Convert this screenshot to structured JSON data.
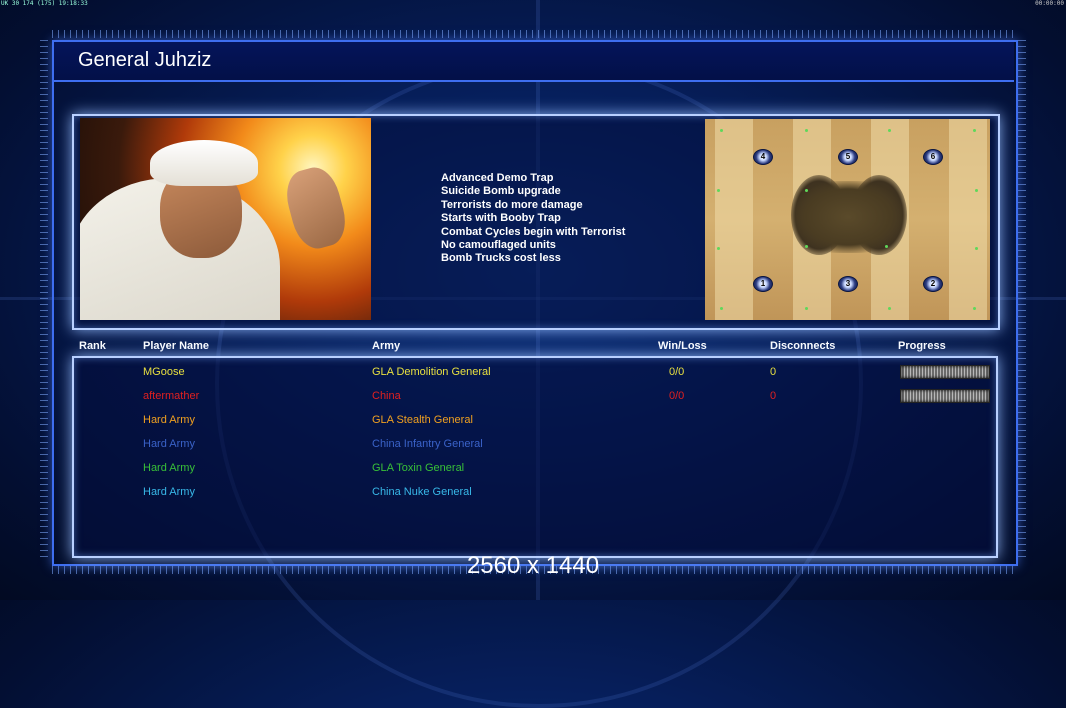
{
  "status_bar": {
    "left": "UK 30 174 (175) 19:18:33",
    "right": "00:00:00"
  },
  "general_title": "General Juhziz",
  "traits": [
    "Advanced Demo Trap",
    "Suicide Bomb upgrade",
    "Terrorists do more damage",
    "Starts with Booby Trap",
    "Combat Cycles begin with Terrorist",
    "No camouflaged units",
    "Bomb Trucks cost less"
  ],
  "map": {
    "spawns": [
      "4",
      "5",
      "6",
      "1",
      "3",
      "2"
    ]
  },
  "table": {
    "headers": {
      "rank": "Rank",
      "player_name": "Player Name",
      "army": "Army",
      "win_loss": "Win/Loss",
      "disconnects": "Disconnects",
      "progress": "Progress"
    },
    "rows": [
      {
        "player": "MGoose",
        "army": "GLA Demolition General",
        "win_loss": "0/0",
        "disconnects": "0",
        "color": "#e8e040",
        "has_progress": true
      },
      {
        "player": "aftermather",
        "army": "China",
        "win_loss": "0/0",
        "disconnects": "0",
        "color": "#e02020",
        "has_progress": true
      },
      {
        "player": "Hard Army",
        "army": "GLA Stealth General",
        "win_loss": "",
        "disconnects": "",
        "color": "#f0a020",
        "has_progress": false
      },
      {
        "player": "Hard Army",
        "army": "China Infantry General",
        "win_loss": "",
        "disconnects": "",
        "color": "#3a62c8",
        "has_progress": false
      },
      {
        "player": "Hard Army",
        "army": "GLA Toxin General",
        "win_loss": "",
        "disconnects": "",
        "color": "#38c038",
        "has_progress": false
      },
      {
        "player": "Hard Army",
        "army": "China Nuke General",
        "win_loss": "",
        "disconnects": "",
        "color": "#38b8e8",
        "has_progress": false
      }
    ]
  },
  "resolution_label": "2560 x 1440",
  "colors": {
    "frame": "#3e6ef0",
    "panel_border": "#b9d0ff"
  }
}
